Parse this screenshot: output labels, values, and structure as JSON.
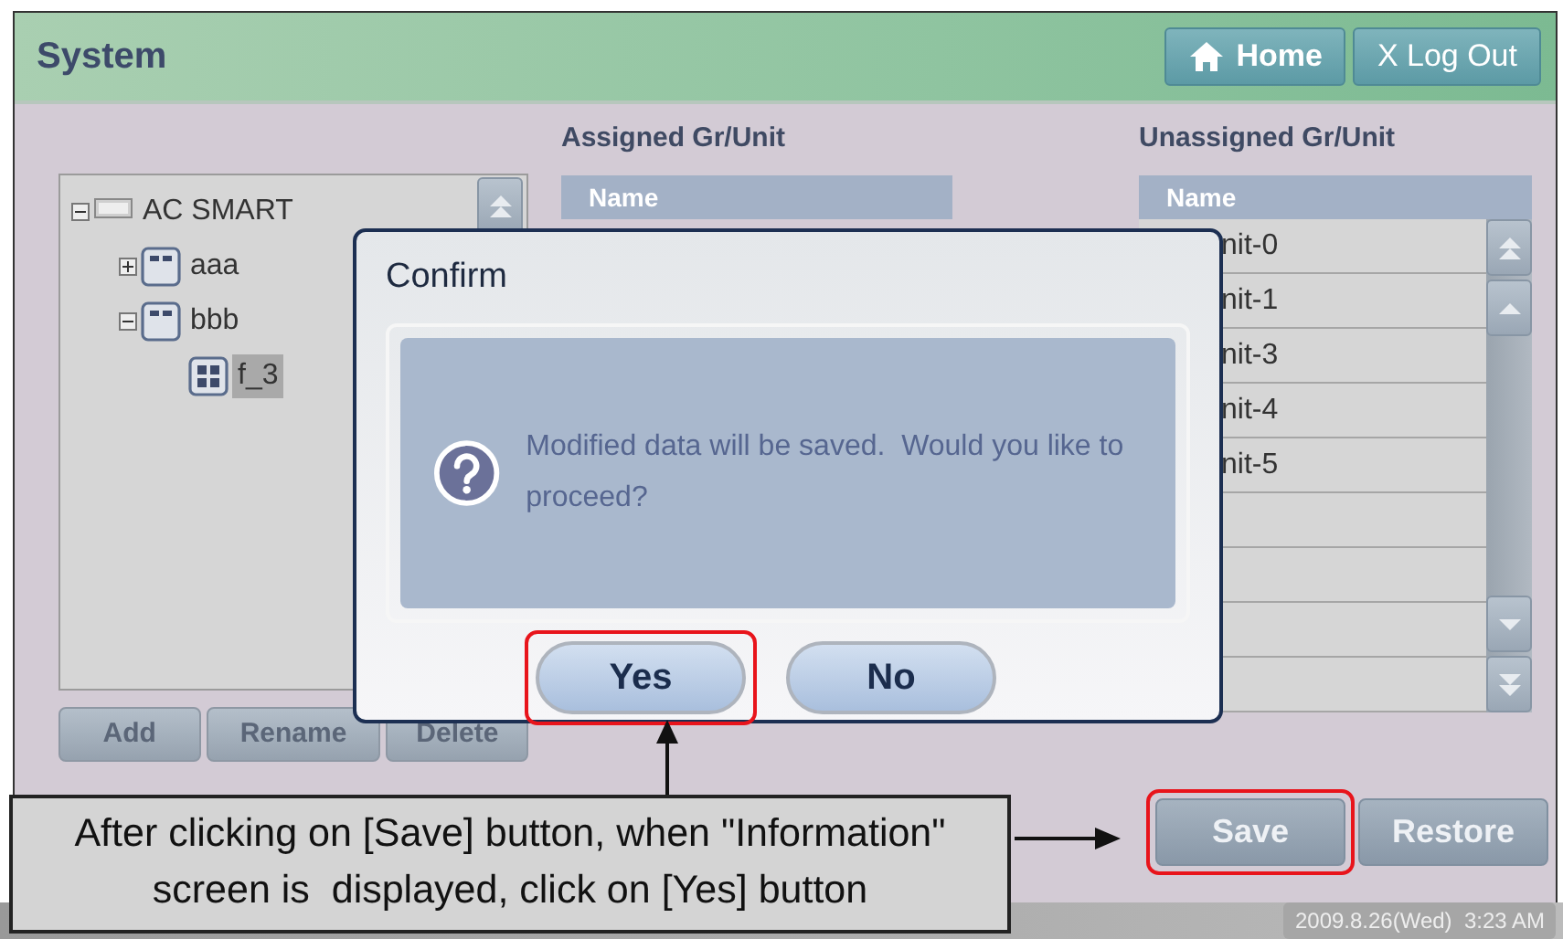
{
  "window": {
    "title": "System"
  },
  "header_buttons": [
    {
      "kind": "home",
      "label": "Home"
    },
    {
      "kind": "logout",
      "label": "X Log Out"
    }
  ],
  "tree": {
    "items": [
      {
        "label": "AC SMART",
        "kind": "site",
        "expanded": true,
        "selected": false,
        "children": [
          {
            "label": "aaa",
            "kind": "group",
            "expanded": false,
            "selected": false
          },
          {
            "label": "bbb",
            "kind": "group",
            "expanded": true,
            "selected": false,
            "children": [
              {
                "label": "f_3",
                "kind": "unit",
                "selected": true
              }
            ]
          }
        ]
      }
    ]
  },
  "tree_buttons": [
    "Add",
    "Rename",
    "Delete"
  ],
  "assigned": {
    "title": "Assigned Gr/Unit",
    "columns": [
      "Name"
    ]
  },
  "unassigned": {
    "title": "Unassigned Gr/Unit",
    "columns": [
      "Name"
    ],
    "rows": [
      "nit-0",
      "nit-1",
      "nit-3",
      "nit-4",
      "nit-5"
    ]
  },
  "actions": [
    {
      "label": "Save",
      "highlighted": true
    },
    {
      "label": "Restore",
      "highlighted": false
    }
  ],
  "status_bar": {
    "datetime": "2009.8.26(Wed)  3:23 AM"
  },
  "dialog": {
    "title": "Confirm",
    "message": "Modified data will be saved.  Would you like to proceed?",
    "buttons": [
      {
        "label": "Yes",
        "highlighted": true
      },
      {
        "label": "No",
        "highlighted": false
      }
    ]
  },
  "annotation": {
    "text": "After clicking on [Save] button, when \"Information\" screen is  displayed, click on [Yes] button"
  }
}
